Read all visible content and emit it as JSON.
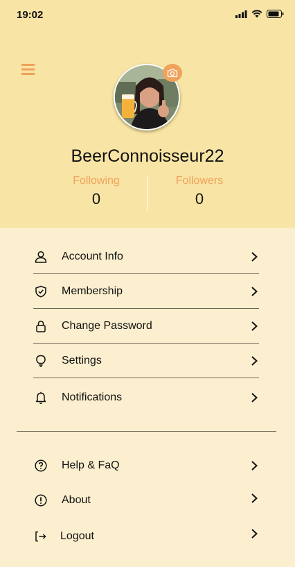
{
  "status_bar": {
    "time": "19:02",
    "icons": [
      "signal-icon",
      "wifi-icon",
      "battery-icon"
    ]
  },
  "header": {
    "menu_icon": "hamburger-menu-icon",
    "avatar_icon": "profile-photo",
    "camera_icon": "camera-icon",
    "username": "BeerConnoisseur22",
    "following_label": "Following",
    "following_count": "0",
    "followers_label": "Followers",
    "followers_count": "0"
  },
  "menu": {
    "items": [
      {
        "label": "Account Info",
        "icon": "user-icon"
      },
      {
        "label": "Membership",
        "icon": "shield-check-icon"
      },
      {
        "label": "Change Password",
        "icon": "lock-icon"
      },
      {
        "label": "Settings",
        "icon": "lightbulb-icon"
      },
      {
        "label": "Notifications",
        "icon": "bell-icon"
      }
    ],
    "secondary": [
      {
        "label": "Help & FaQ",
        "icon": "question-circle-icon"
      },
      {
        "label": "About",
        "icon": "exclamation-circle-icon"
      },
      {
        "label": "Logout",
        "icon": "logout-icon"
      }
    ]
  },
  "colors": {
    "header_bg": "#f8e4a4",
    "body_bg": "#fbefcf",
    "accent": "#f0a15a"
  }
}
